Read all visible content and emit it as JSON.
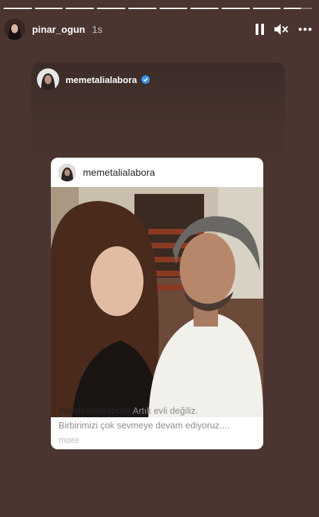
{
  "story": {
    "username": "pinar_ogun",
    "time": "1s",
    "progress_segments_done": 9,
    "progress_segments_total": 10,
    "controls": [
      "pause-icon",
      "mute-icon",
      "more-icon"
    ]
  },
  "shared": {
    "username": "memetalialabora",
    "verified": true
  },
  "post": {
    "username": "memetalialabora",
    "caption_user": "memetalialabora",
    "caption_line1": "Artık evli değiliz.",
    "caption_line2": "Birbirimizi çok sevmeye devam ediyoruz....",
    "more": "more"
  },
  "colors": {
    "background": "#4a3530",
    "verified": "#3897f0"
  }
}
